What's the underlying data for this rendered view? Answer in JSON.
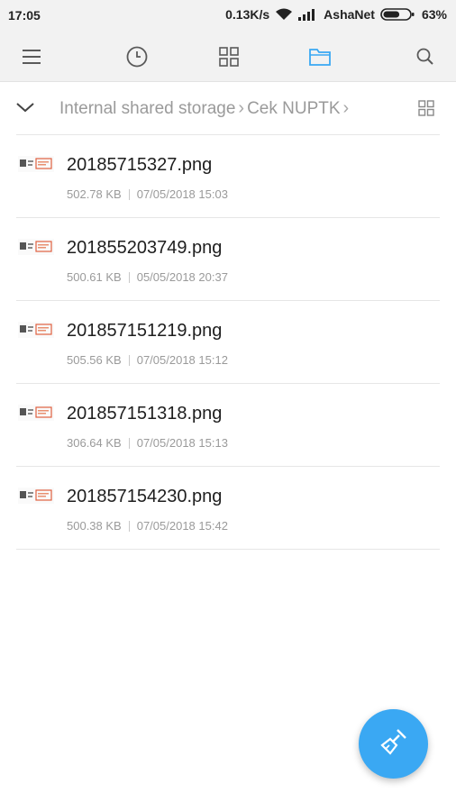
{
  "status": {
    "time": "17:05",
    "speed": "0.13K/s",
    "network": "AshaNet",
    "battery": "63%",
    "battery_level": 0.63
  },
  "toolbar": {
    "icons": [
      "menu-icon",
      "recent-clock-icon",
      "categories-grid-icon",
      "folder-icon",
      "search-icon"
    ],
    "accent": "#3aa8f3"
  },
  "breadcrumb": {
    "items": [
      "Internal shared storage",
      "Cek NUPTK"
    ]
  },
  "files": [
    {
      "name": "20185715327.png",
      "size": "502.78 KB",
      "date": "07/05/2018 15:03"
    },
    {
      "name": "201855203749.png",
      "size": "500.61 KB",
      "date": "05/05/2018 20:37"
    },
    {
      "name": "201857151219.png",
      "size": "505.56 KB",
      "date": "07/05/2018 15:12"
    },
    {
      "name": "201857151318.png",
      "size": "306.64 KB",
      "date": "07/05/2018 15:13"
    },
    {
      "name": "201857154230.png",
      "size": "500.38 KB",
      "date": "07/05/2018 15:42"
    }
  ],
  "fab": {
    "icon": "clean-brush-icon"
  }
}
